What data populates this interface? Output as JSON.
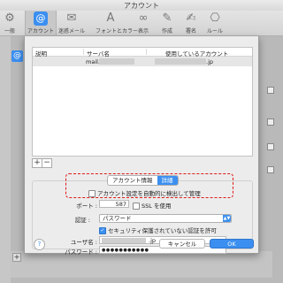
{
  "window": {
    "title": "アカウント"
  },
  "toolbar": {
    "items": [
      {
        "label": "一般",
        "icon": "general-icon"
      },
      {
        "label": "アカウント",
        "icon": "at-sign-icon",
        "active": true
      },
      {
        "label": "迷惑メール",
        "icon": "junk-mail-icon"
      },
      {
        "label": "フォントとカラー",
        "icon": "fonts-colors-icon"
      },
      {
        "label": "表示",
        "icon": "glasses-icon"
      },
      {
        "label": "作成",
        "icon": "compose-icon"
      },
      {
        "label": "署名",
        "icon": "signature-icon"
      },
      {
        "label": "ルール",
        "icon": "rules-icon"
      }
    ]
  },
  "smtp_table": {
    "columns": [
      "説明",
      "サーバ名",
      "使用しているアカウント"
    ],
    "rows": [
      {
        "description": "",
        "server": "mail.",
        "account": ".jp"
      }
    ]
  },
  "list_controls": {
    "add": "+",
    "remove": "−"
  },
  "tabs": [
    {
      "label": "アカウント情報"
    },
    {
      "label": "詳細",
      "active": true
    }
  ],
  "form": {
    "auto_detect_label": "アカウント設定を自動的に検出して管理",
    "auto_detect_checked": false,
    "port_label": "ポート :",
    "port_value": "587",
    "ssl_label": "SSL を使用",
    "ssl_checked": false,
    "auth_label": "認証 :",
    "auth_value": "パスワード",
    "insecure_label": "セキュリティ保護されていない認証を許可",
    "insecure_checked": true,
    "username_label": "ユーザ名 :",
    "username_value": ".jp",
    "password_label": "パスワード :",
    "password_value": "●●●●●●●●●●●"
  },
  "buttons": {
    "help": "?",
    "cancel": "キャンセル",
    "ok": "OK"
  },
  "colors": {
    "accent": "#3b8ff0",
    "highlight": "#e01818"
  }
}
